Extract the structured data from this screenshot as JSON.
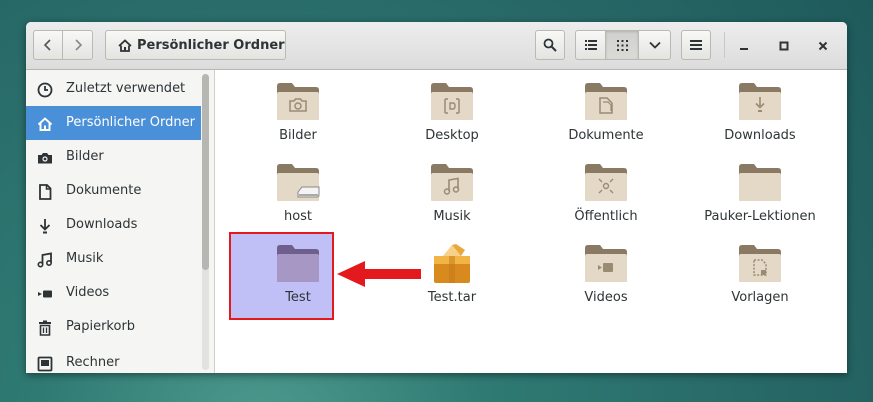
{
  "breadcrumb": {
    "label": "Persönlicher Ordner"
  },
  "sidebar": {
    "items": [
      {
        "label": "Zuletzt verwendet",
        "icon": "clock-icon"
      },
      {
        "label": "Persönlicher Ordner",
        "icon": "home-icon",
        "selected": true
      },
      {
        "label": "Bilder",
        "icon": "camera-icon"
      },
      {
        "label": "Dokumente",
        "icon": "document-icon"
      },
      {
        "label": "Downloads",
        "icon": "download-icon"
      },
      {
        "label": "Musik",
        "icon": "music-icon"
      },
      {
        "label": "Videos",
        "icon": "video-icon"
      },
      {
        "label": "Papierkorb",
        "icon": "trash-icon"
      },
      {
        "label": "Rechner",
        "icon": "computer-icon"
      }
    ]
  },
  "files": [
    {
      "name": "Bilder",
      "type": "folder",
      "emblem": "camera"
    },
    {
      "name": "Desktop",
      "type": "folder",
      "emblem": "desktop"
    },
    {
      "name": "Dokumente",
      "type": "folder",
      "emblem": "document"
    },
    {
      "name": "Downloads",
      "type": "folder",
      "emblem": "download"
    },
    {
      "name": "host",
      "type": "folder",
      "emblem": "drive"
    },
    {
      "name": "Musik",
      "type": "folder",
      "emblem": "music"
    },
    {
      "name": "Öffentlich",
      "type": "folder",
      "emblem": "share"
    },
    {
      "name": "Pauker-Lektionen",
      "type": "folder",
      "emblem": "none"
    },
    {
      "name": "Test",
      "type": "folder",
      "emblem": "none",
      "highlighted": true
    },
    {
      "name": "Test.tar",
      "type": "archive"
    },
    {
      "name": "Videos",
      "type": "folder",
      "emblem": "video"
    },
    {
      "name": "Vorlagen",
      "type": "folder",
      "emblem": "template"
    }
  ],
  "colors": {
    "selection": "#4a90d9",
    "highlight_box": "#e4191e",
    "highlight_fill": "#c0c0f6",
    "arrow": "#e4191e"
  }
}
